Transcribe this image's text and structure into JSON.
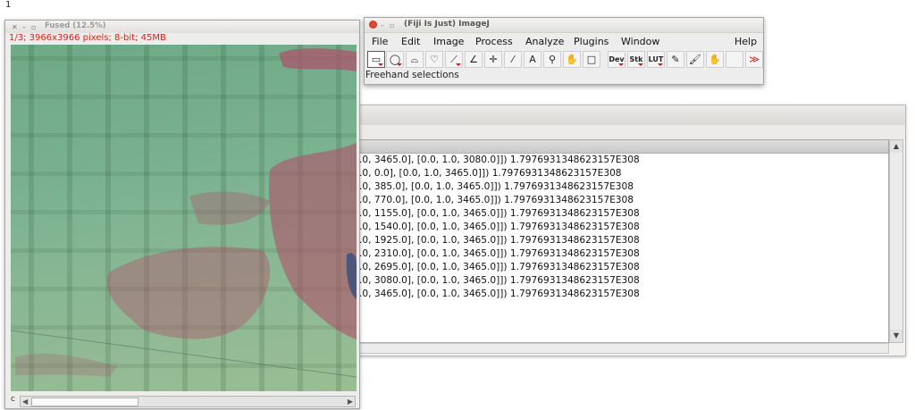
{
  "desktop": {
    "label": "1"
  },
  "image_window": {
    "title": "Fused (12.5%)",
    "info": "1/3; 3966x3966 pixels; 8-bit; 45MB",
    "channel_label": "c",
    "colors": {
      "info_text": "#d1241c",
      "tissue": "#b0506a"
    }
  },
  "imagej": {
    "title": "(Fiji Is Just) ImageJ",
    "menus": [
      "File",
      "Edit",
      "Image",
      "Process",
      "Analyze",
      "Plugins",
      "Window",
      "Help"
    ],
    "tools": [
      {
        "name": "rectangle-tool-icon",
        "glyph": "▭",
        "active": true
      },
      {
        "name": "oval-tool-icon",
        "glyph": "◯"
      },
      {
        "name": "polygon-tool-icon",
        "glyph": "⌓"
      },
      {
        "name": "freehand-tool-icon",
        "glyph": "♡"
      },
      {
        "name": "line-tool-icon",
        "glyph": "⟋"
      },
      {
        "name": "angle-tool-icon",
        "glyph": "∠"
      },
      {
        "name": "point-tool-icon",
        "glyph": "✛"
      },
      {
        "name": "wand-tool-icon",
        "glyph": "⁄"
      },
      {
        "name": "text-tool-icon",
        "glyph": "A"
      },
      {
        "name": "magnifier-tool-icon",
        "glyph": "⚲"
      },
      {
        "name": "hand-tool-icon",
        "glyph": "✋"
      },
      {
        "name": "color-picker-icon",
        "glyph": "□"
      },
      {
        "name": "dev-menu-icon",
        "glyph": "Dev"
      },
      {
        "name": "stk-menu-icon",
        "glyph": "Stk"
      },
      {
        "name": "lut-menu-icon",
        "glyph": "LUT"
      },
      {
        "name": "pencil-tool-icon",
        "glyph": "✎"
      },
      {
        "name": "brush-tool-icon",
        "glyph": "🖌"
      },
      {
        "name": "flood-fill-tool-icon",
        "glyph": "✋"
      },
      {
        "name": "empty-slot",
        "glyph": ""
      },
      {
        "name": "more-tools-icon",
        "glyph": "≫"
      }
    ],
    "status": "Freehand selections"
  },
  "log": {
    "lines": [
      ".0, 3465.0], [0.0, 1.0, 3080.0]]) 1.7976931348623157E308",
      ".0, 0.0], [0.0, 1.0, 3465.0]]) 1.7976931348623157E308",
      ".0, 385.0], [0.0, 1.0, 3465.0]]) 1.7976931348623157E308",
      ".0, 770.0], [0.0, 1.0, 3465.0]]) 1.7976931348623157E308",
      ".0, 1155.0], [0.0, 1.0, 3465.0]]) 1.7976931348623157E308",
      ".0, 1540.0], [0.0, 1.0, 3465.0]]) 1.7976931348623157E308",
      ".0, 1925.0], [0.0, 1.0, 3465.0]]) 1.7976931348623157E308",
      ".0, 2310.0], [0.0, 1.0, 3465.0]]) 1.7976931348623157E308",
      ".0, 2695.0], [0.0, 1.0, 3465.0]]) 1.7976931348623157E308",
      ".0, 3080.0], [0.0, 1.0, 3465.0]]) 1.7976931348623157E308",
      ".0, 3465.0], [0.0, 1.0, 3465.0]]) 1.7976931348623157E308"
    ]
  }
}
